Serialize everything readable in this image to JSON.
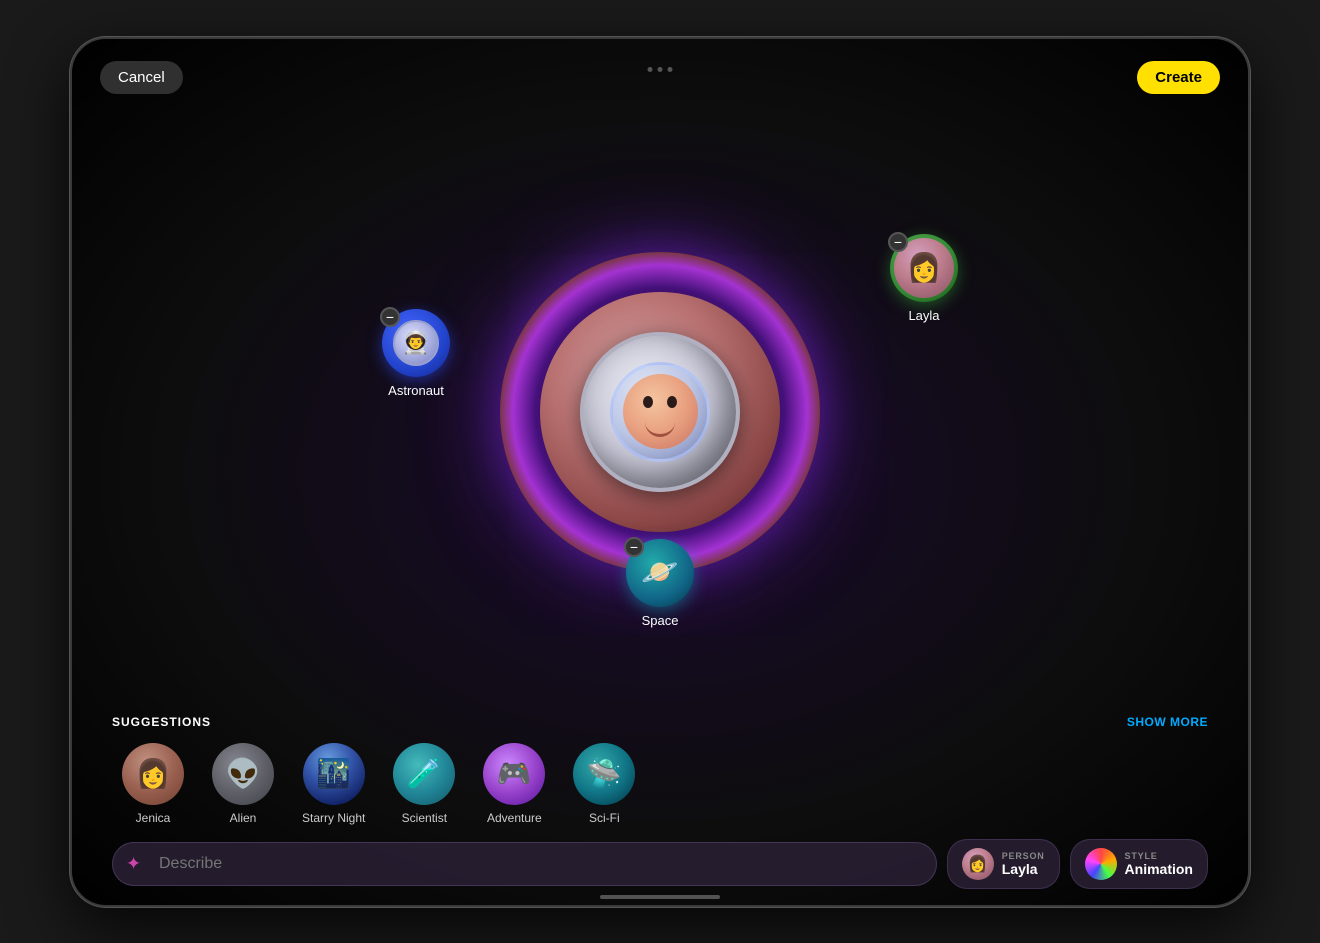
{
  "buttons": {
    "cancel": "Cancel",
    "create": "Create",
    "show_more": "SHOW MORE"
  },
  "central": {
    "person": "Layla",
    "style": "Astronaut"
  },
  "floating_items": [
    {
      "id": "astronaut",
      "label": "Astronaut",
      "emoji": "👨‍🚀"
    },
    {
      "id": "layla",
      "label": "Layla",
      "emoji": "👩"
    },
    {
      "id": "space",
      "label": "Space",
      "emoji": "🪐"
    }
  ],
  "suggestions": {
    "title": "SUGGESTIONS",
    "items": [
      {
        "id": "jenica",
        "label": "Jenica",
        "emoji": "👩"
      },
      {
        "id": "alien",
        "label": "Alien",
        "emoji": "👽"
      },
      {
        "id": "starry_night",
        "label": "Starry Night",
        "emoji": "🌃"
      },
      {
        "id": "scientist",
        "label": "Scientist",
        "emoji": "🧪"
      },
      {
        "id": "adventure",
        "label": "Adventure",
        "emoji": "🎮"
      },
      {
        "id": "scifi",
        "label": "Sci-Fi",
        "emoji": "🛸"
      }
    ]
  },
  "bottom_bar": {
    "describe_placeholder": "Describe",
    "person_label": "PERSON",
    "person_value": "Layla",
    "style_label": "STYLE",
    "style_value": "Animation"
  }
}
